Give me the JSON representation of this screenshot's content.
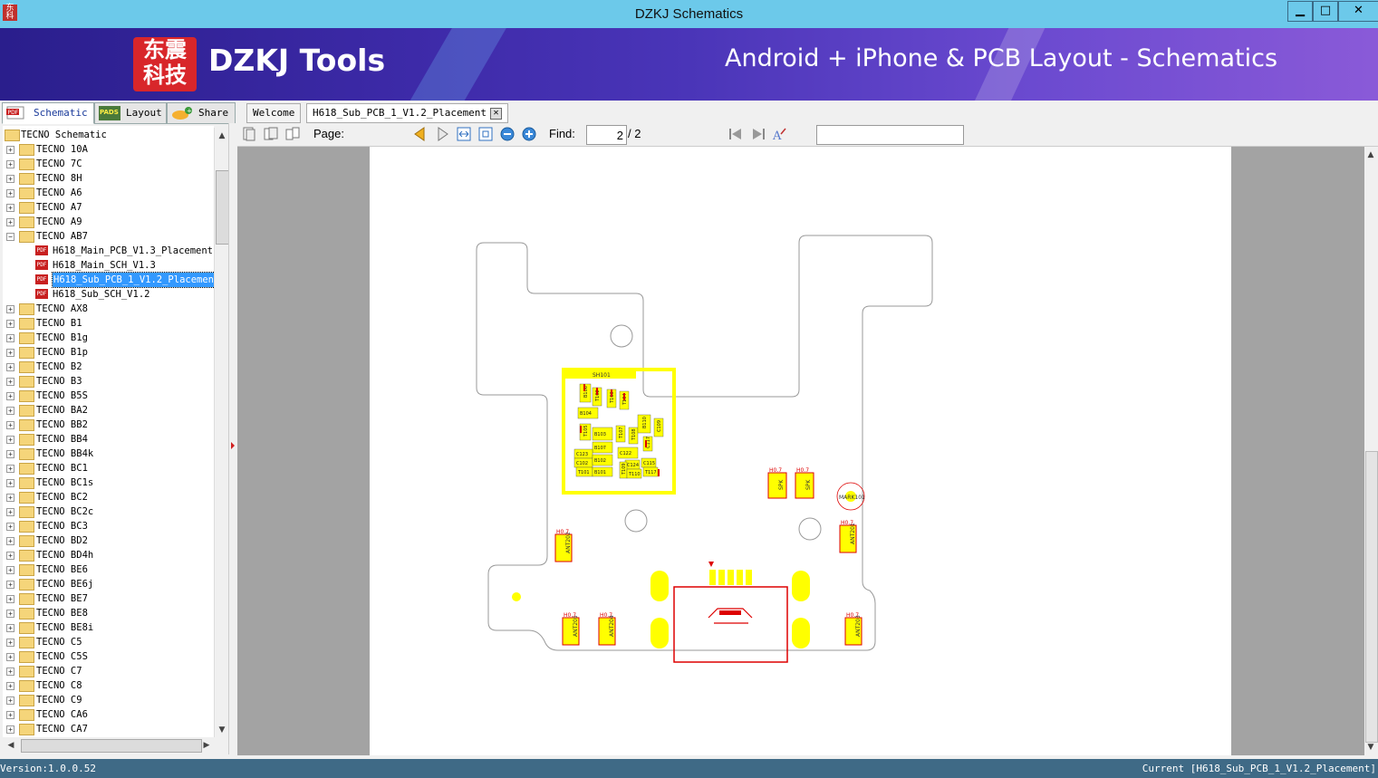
{
  "window": {
    "title": "DZKJ Schematics",
    "minimize": "▁",
    "maximize": "□",
    "close": "✕"
  },
  "banner": {
    "logo_line1": "东震",
    "logo_line2": "科技",
    "brand": "DZKJ Tools",
    "tagline": "Android + iPhone & PCB Layout - Schematics"
  },
  "left_tabs": [
    {
      "label": "Schematic",
      "icon": "pdf-icon"
    },
    {
      "label": "Layout",
      "icon": "pads-icon"
    },
    {
      "label": "Share",
      "icon": "cloud-icon"
    }
  ],
  "tree": {
    "root": "TECNO Schematic",
    "folders_before": [
      "TECNO 10A",
      "TECNO 7C",
      "TECNO 8H",
      "TECNO A6",
      "TECNO A7",
      "TECNO A9"
    ],
    "open_folder": "TECNO AB7",
    "files": [
      "H618_Main_PCB_V1.3_Placement",
      "H618_Main_SCH_V1.3",
      "H618_Sub_PCB_1_V1.2_Placement",
      "H618_Sub_SCH_V1.2"
    ],
    "selected_file_index": 2,
    "folders_after": [
      "TECNO AX8",
      "TECNO B1",
      "TECNO B1g",
      "TECNO B1p",
      "TECNO B2",
      "TECNO B3",
      "TECNO B5S",
      "TECNO BA2",
      "TECNO BB2",
      "TECNO BB4",
      "TECNO BB4k",
      "TECNO BC1",
      "TECNO BC1s",
      "TECNO BC2",
      "TECNO BC2c",
      "TECNO BC3",
      "TECNO BD2",
      "TECNO BD4h",
      "TECNO BE6",
      "TECNO BE6j",
      "TECNO BE7",
      "TECNO BE8",
      "TECNO BE8i",
      "TECNO C5",
      "TECNO C5S",
      "TECNO C7",
      "TECNO C8",
      "TECNO C9",
      "TECNO CA6",
      "TECNO CA7"
    ]
  },
  "doc_tabs": [
    {
      "label": "Welcome"
    },
    {
      "label": "H618_Sub_PCB_1_V1.2_Placement",
      "closable": true
    }
  ],
  "toolbar": {
    "page_label": "Page:",
    "page_value": "2",
    "page_total": "/ 2",
    "find_label": "Find:",
    "find_value": ""
  },
  "pcb": {
    "labels": {
      "sh101": "SH101",
      "mark101": "MARK101",
      "h07": "H0.7",
      "spk1": "SPK",
      "spk2": "SPK",
      "ant201": "ANT201",
      "ant202": "ANT202",
      "ant203": "ANT203",
      "ant204": "ANT204",
      "ant205": "ANT205"
    },
    "components": [
      "B106",
      "T102",
      "T103",
      "T104",
      "B104",
      "T105",
      "B103",
      "T107",
      "T108",
      "B110",
      "C109",
      "B107",
      "C122",
      "C123",
      "C102",
      "B102",
      "C124",
      "C115",
      "T101",
      "B101",
      "T109",
      "T110",
      "T117",
      "C117"
    ],
    "colors": {
      "silk": "#ffff00",
      "outline": "#999999",
      "copper": "#dd0000"
    }
  },
  "status": {
    "version": "Version:1.0.0.52",
    "current": "Current [H618_Sub_PCB_1_V1.2_Placement]"
  },
  "colors": {
    "titlebar": "#6cc9ea",
    "status": "#3f6a86",
    "selection": "#3399ff"
  }
}
